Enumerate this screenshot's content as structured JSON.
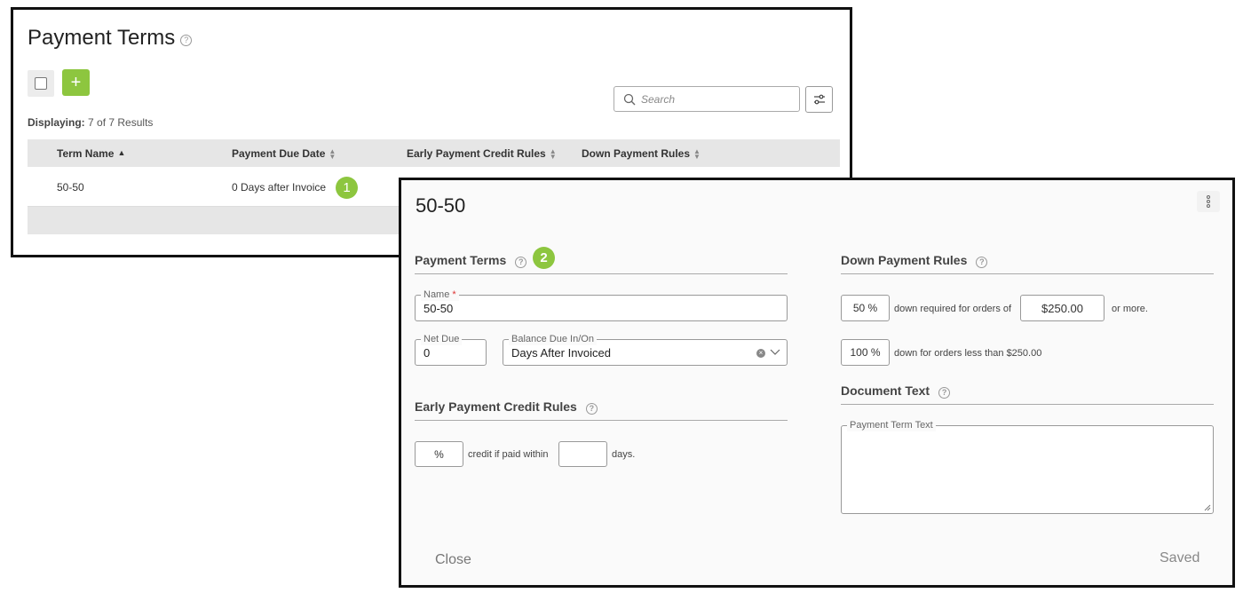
{
  "list": {
    "title": "Payment Terms",
    "help_icon": "?",
    "add_label": "+",
    "displaying_label": "Displaying:",
    "displaying_value": "7 of 7 Results",
    "search_placeholder": "Search",
    "columns": [
      "Term Name",
      "Payment Due Date",
      "Early Payment Credit Rules",
      "Down Payment Rules"
    ],
    "rows": [
      {
        "term_name": "50-50",
        "payment_due_date": "0 Days after Invoice",
        "early_payment": "",
        "down_payment": ""
      }
    ],
    "badge": "1"
  },
  "detail": {
    "title": "50-50",
    "payment_terms": {
      "heading": "Payment Terms",
      "badge": "2",
      "name_label": "Name",
      "name_required": "*",
      "name_value": "50-50",
      "net_due_label": "Net Due",
      "net_due_value": "0",
      "balance_label": "Balance Due In/On",
      "balance_value": "Days After Invoiced"
    },
    "early_payment": {
      "heading": "Early Payment Credit Rules",
      "percent_value": "%",
      "credit_text": "credit if paid within",
      "days_value": "",
      "days_text": "days."
    },
    "down_payment": {
      "heading": "Down Payment Rules",
      "percent1": "50 %",
      "text1": "down required for orders of",
      "amount": "$250.00",
      "text2": "or more.",
      "percent2": "100 %",
      "text3": "down for orders less than $250.00"
    },
    "document_text": {
      "heading": "Document Text",
      "field_label": "Payment Term Text",
      "value": ""
    },
    "close_label": "Close",
    "saved_label": "Saved"
  },
  "icons": [
    "help-icon",
    "search-icon",
    "filter-icon",
    "sort-icon",
    "kebab-icon",
    "clear-icon",
    "chevron-down-icon",
    "resize-icon"
  ],
  "colors": {
    "accent": "#8dc63f",
    "header_bg": "#e6e6e6",
    "border": "#111111"
  }
}
